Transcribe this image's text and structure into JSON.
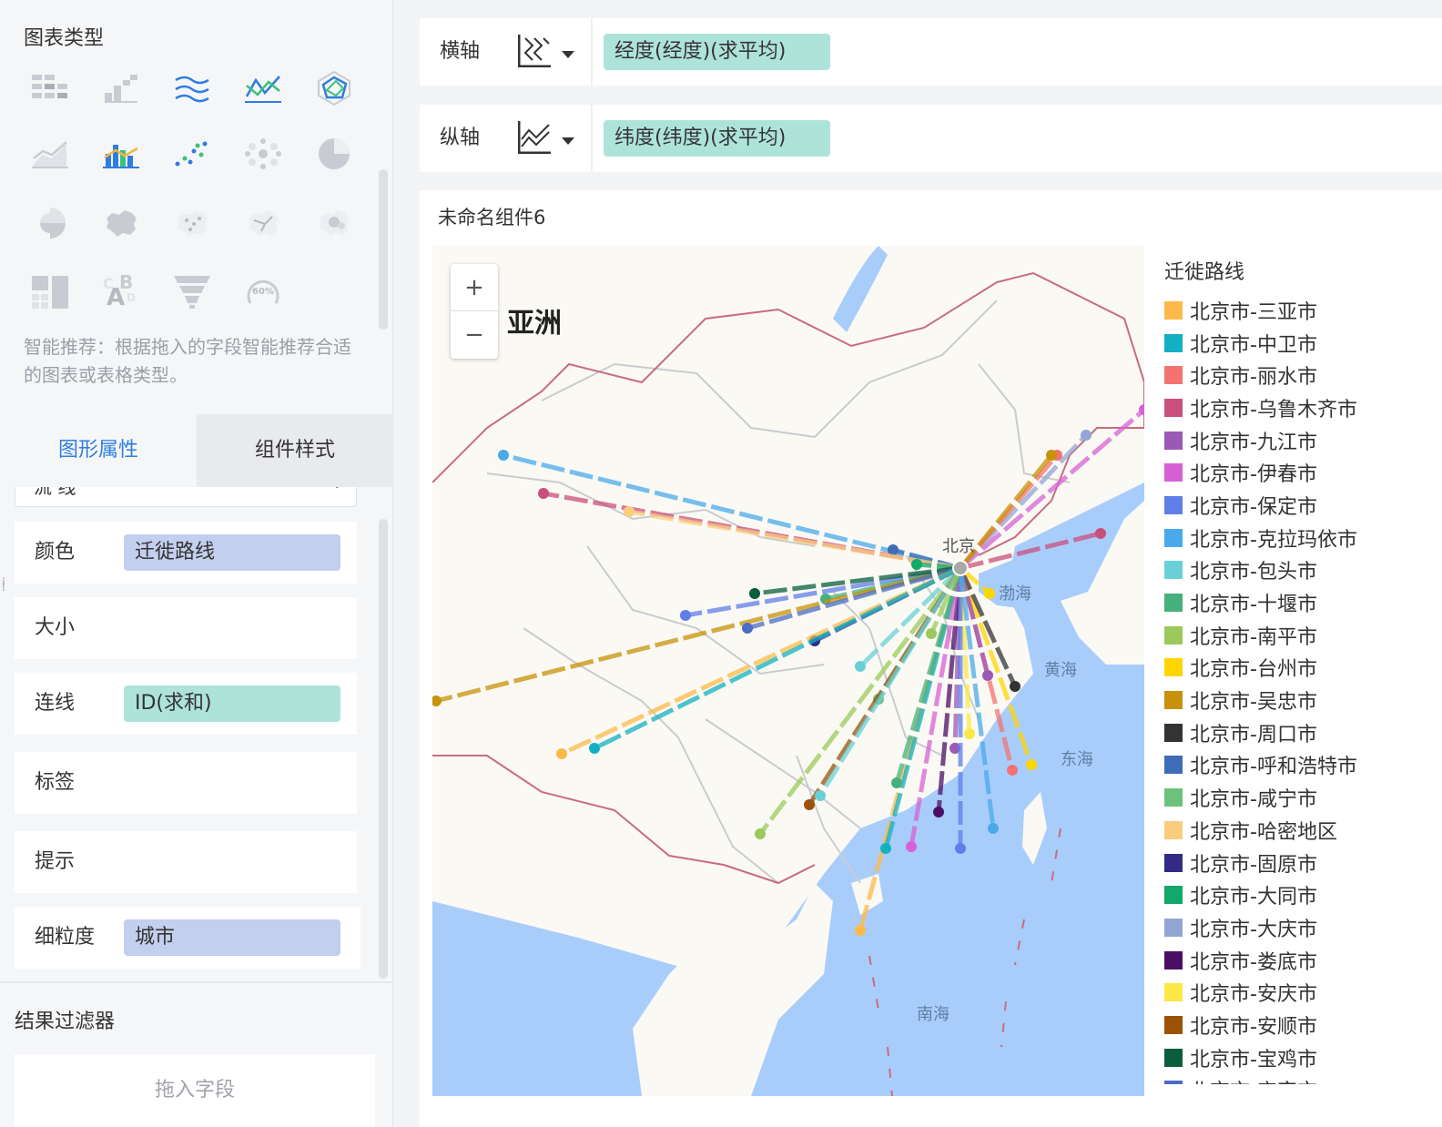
{
  "left_panel": {
    "chart_type_title": "图表类型",
    "recommend_text": "智能推荐：根据拖入的字段智能推荐合适的图表或表格类型。",
    "tabs": [
      {
        "label": "图形属性"
      },
      {
        "label": "组件样式"
      }
    ],
    "partial_select": "流 线",
    "props": [
      {
        "label": "颜色",
        "field": "迁徙路线"
      },
      {
        "label": "大小",
        "field": ""
      },
      {
        "label": "连线",
        "field": "ID(求和)"
      },
      {
        "label": "标签",
        "field": ""
      },
      {
        "label": "提示",
        "field": ""
      },
      {
        "label": "细粒度",
        "field": "城市"
      }
    ],
    "filter_title": "结果过滤器",
    "filter_drop": "拖入字段",
    "gauge_text": "60%"
  },
  "axes": {
    "x": {
      "label": "横轴",
      "field": "经度(经度)(求平均)"
    },
    "y": {
      "label": "纵轴",
      "field": "纬度(纬度)(求平均)"
    }
  },
  "component": {
    "title": "未命名组件6",
    "map": {
      "continent": "亚洲",
      "origin_city": "北京",
      "seas": [
        "渤海",
        "黄海",
        "东海",
        "南海"
      ],
      "zoom_in": "+",
      "zoom_out": "−"
    },
    "legend": {
      "title": "迁徙路线",
      "items": [
        {
          "label": "北京市-三亚市",
          "color": "#fdb94a"
        },
        {
          "label": "北京市-中卫市",
          "color": "#13b0c2"
        },
        {
          "label": "北京市-丽水市",
          "color": "#f47272"
        },
        {
          "label": "北京市-乌鲁木齐市",
          "color": "#c94f7c"
        },
        {
          "label": "北京市-九江市",
          "color": "#9b59b6"
        },
        {
          "label": "北京市-伊春市",
          "color": "#d661d6"
        },
        {
          "label": "北京市-保定市",
          "color": "#5e7ee8"
        },
        {
          "label": "北京市-克拉玛依市",
          "color": "#4aa9ea"
        },
        {
          "label": "北京市-包头市",
          "color": "#6ad0d8"
        },
        {
          "label": "北京市-十堰市",
          "color": "#46b07c"
        },
        {
          "label": "北京市-南平市",
          "color": "#9cc95b"
        },
        {
          "label": "北京市-台州市",
          "color": "#ffd500"
        },
        {
          "label": "北京市-吴忠市",
          "color": "#c7920a"
        },
        {
          "label": "北京市-周口市",
          "color": "#333333"
        },
        {
          "label": "北京市-呼和浩特市",
          "color": "#3f6cb7"
        },
        {
          "label": "北京市-咸宁市",
          "color": "#6ec17b"
        },
        {
          "label": "北京市-哈密地区",
          "color": "#f9cd7d"
        },
        {
          "label": "北京市-固原市",
          "color": "#312b85"
        },
        {
          "label": "北京市-大同市",
          "color": "#11a86a"
        },
        {
          "label": "北京市-大庆市",
          "color": "#91a6d4"
        },
        {
          "label": "北京市-娄底市",
          "color": "#4a0f63"
        },
        {
          "label": "北京市-安庆市",
          "color": "#fbe844"
        },
        {
          "label": "北京市-安顺市",
          "color": "#9a5209"
        },
        {
          "label": "北京市-宝鸡市",
          "color": "#0b5e3c"
        },
        {
          "label": "北京市-宜宾市",
          "color": "#4a6cc4"
        }
      ]
    }
  }
}
